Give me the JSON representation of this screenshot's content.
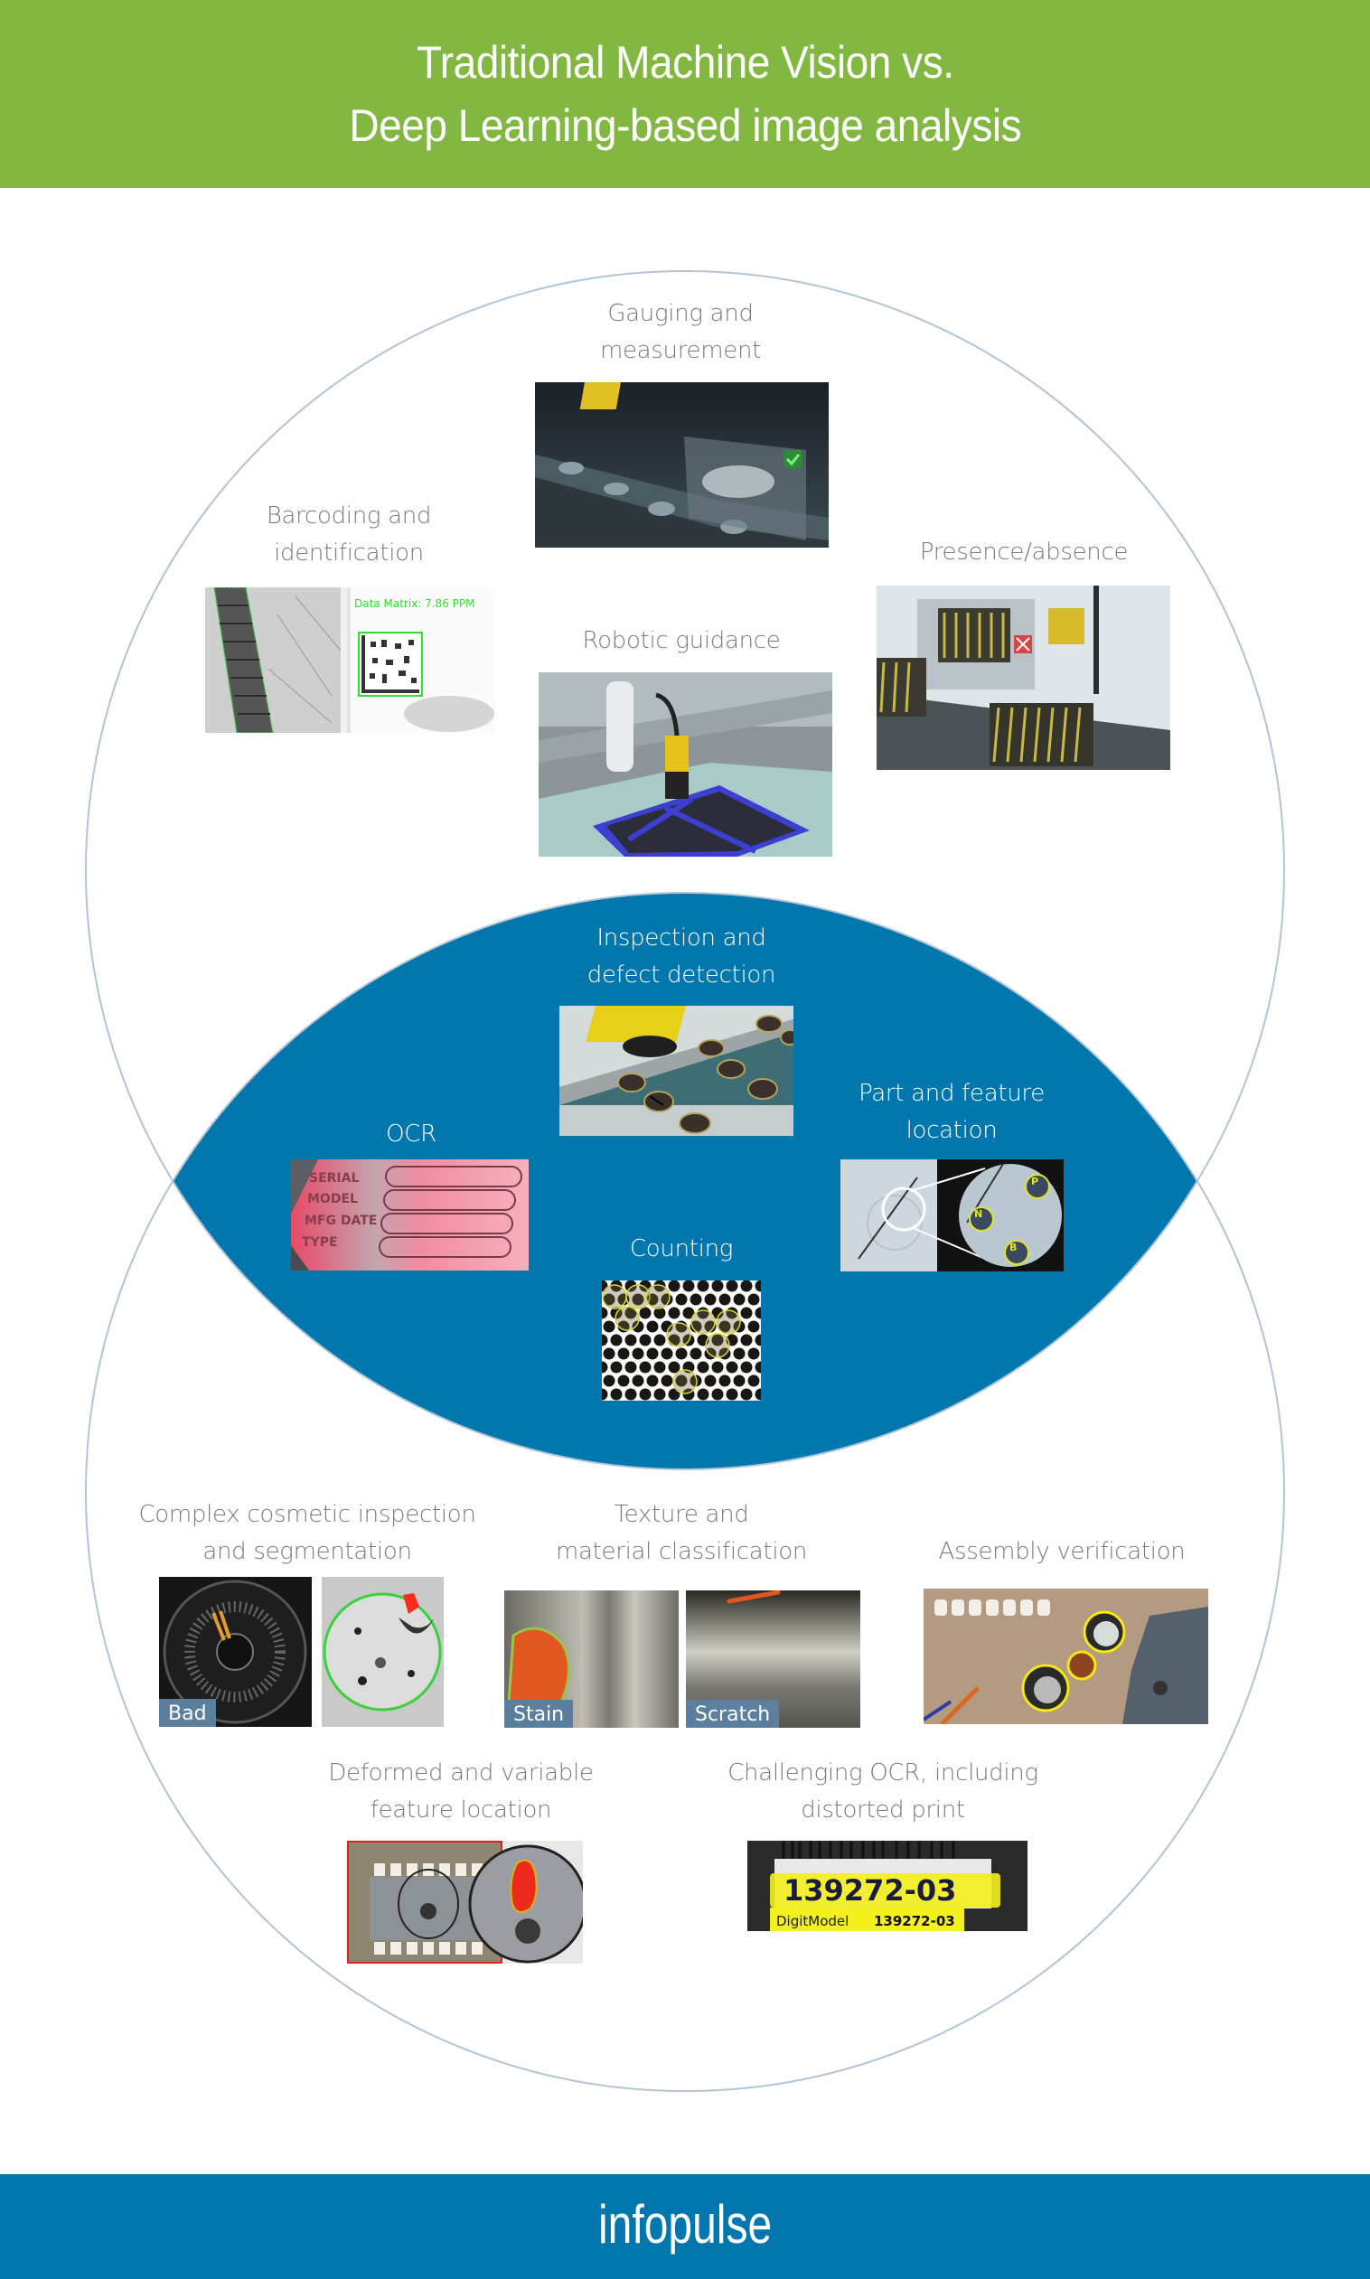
{
  "header": {
    "title_line1": "Traditional Machine Vision vs.",
    "title_line2": "Deep Learning-based image analysis"
  },
  "colors": {
    "header_bg": "#82b841",
    "intersection_fill": "#0177ad",
    "circle_stroke": "#b0c4d6",
    "footer_bg": "#0177ad",
    "label_text": "#7a7a7a",
    "tag_bg": "#5b7f9c"
  },
  "traditional": {
    "items": [
      {
        "label_line1": "Gauging and",
        "label_line2": "measurement",
        "image": "conveyor camera measuring parts with check mark overlay"
      },
      {
        "label_line1": "Barcoding and",
        "label_line2": "identification",
        "image": "barcode and data matrix scans",
        "overlay_text": "Data Matrix: 7.86 PPM"
      },
      {
        "label_line1": "Presence/absence",
        "label_line2": "",
        "image": "camera over trays of coils with red X indicator"
      },
      {
        "label_line1": "Robotic guidance",
        "label_line2": "",
        "image": "robot arm with camera over blue tray"
      }
    ]
  },
  "both": {
    "items": [
      {
        "label_line1": "Inspection and",
        "label_line2": "defect detection",
        "image": "camera over cookies on conveyor"
      },
      {
        "label_line1": "OCR",
        "label_line2": "",
        "image": "embossed serial plate text"
      },
      {
        "label_line1": "Part and feature",
        "label_line2": "location",
        "image": "medical kit with magnified located features",
        "markers": [
          "P",
          "N",
          "B"
        ]
      },
      {
        "label_line1": "Counting",
        "label_line2": "",
        "image": "hexagonal pattern of holes with counted marks"
      }
    ]
  },
  "deep_learning": {
    "items": [
      {
        "label_line1": "Complex cosmetic inspection",
        "label_line2": "and segmentation",
        "image": "disc inspection",
        "tags": [
          "Bad"
        ]
      },
      {
        "label_line1": "Texture and",
        "label_line2": "material classification",
        "image": "metal surface defects",
        "tags": [
          "Stain",
          "Scratch"
        ]
      },
      {
        "label_line1": "Assembly verification",
        "label_line2": "",
        "image": "circuit board with highlighted capacitors"
      },
      {
        "label_line1": "Deformed and variable",
        "label_line2": "feature location",
        "image": "IC chip with magnified defect"
      },
      {
        "label_line1": "Challenging OCR, including",
        "label_line2": "distorted print",
        "image": "distorted label print",
        "ocr_text": "139272-03",
        "ocr_result_label": "DigitModel",
        "ocr_result_value": "139272-03"
      }
    ]
  },
  "footer": {
    "logo": "infopulse"
  }
}
